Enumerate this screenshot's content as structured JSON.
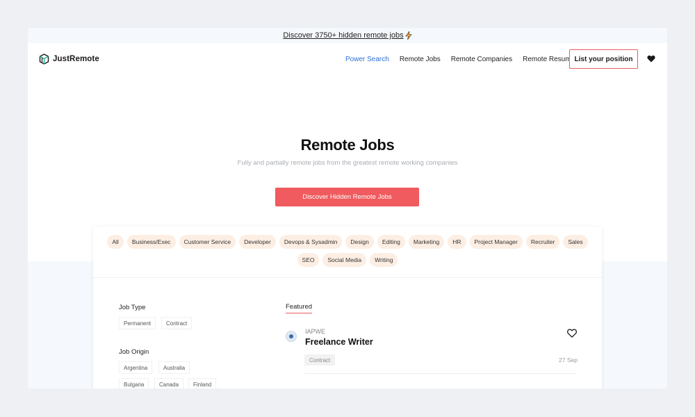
{
  "banner": {
    "text": "Discover 3750+ hidden remote jobs",
    "icon": "lightning-icon"
  },
  "brand": {
    "name": "JustRemote",
    "accent": "#ef5b5e",
    "link": "#2c6fd6"
  },
  "nav": {
    "links": [
      "Power Search",
      "Remote Jobs",
      "Remote Companies",
      "Remote Resume"
    ],
    "active": "Power Search",
    "cta": "List your position",
    "favorites_icon": "heart-icon"
  },
  "hero": {
    "title": "Remote Jobs",
    "subtitle": "Fully and partially remote jobs from the greatest remote working companies",
    "button": "Discover Hidden Remote Jobs"
  },
  "categories": [
    "All",
    "Business/Exec",
    "Customer Service",
    "Developer",
    "Devops & Sysadmin",
    "Design",
    "Editing",
    "Marketing",
    "HR",
    "Project Manager",
    "Recruiter",
    "Sales",
    "SEO",
    "Social Media",
    "Writing"
  ],
  "filters": {
    "job_type": {
      "label": "Job Type",
      "options": [
        "Permanent",
        "Contract"
      ]
    },
    "job_origin": {
      "label": "Job Origin",
      "options": [
        "Argentina",
        "Australia",
        "Bulgaria",
        "Canada",
        "Finland"
      ]
    }
  },
  "listings": {
    "tab": "Featured",
    "jobs": [
      {
        "company": "IAPWE",
        "title": "Freelance Writer",
        "type": "Contract",
        "date": "27 Sep"
      }
    ]
  }
}
